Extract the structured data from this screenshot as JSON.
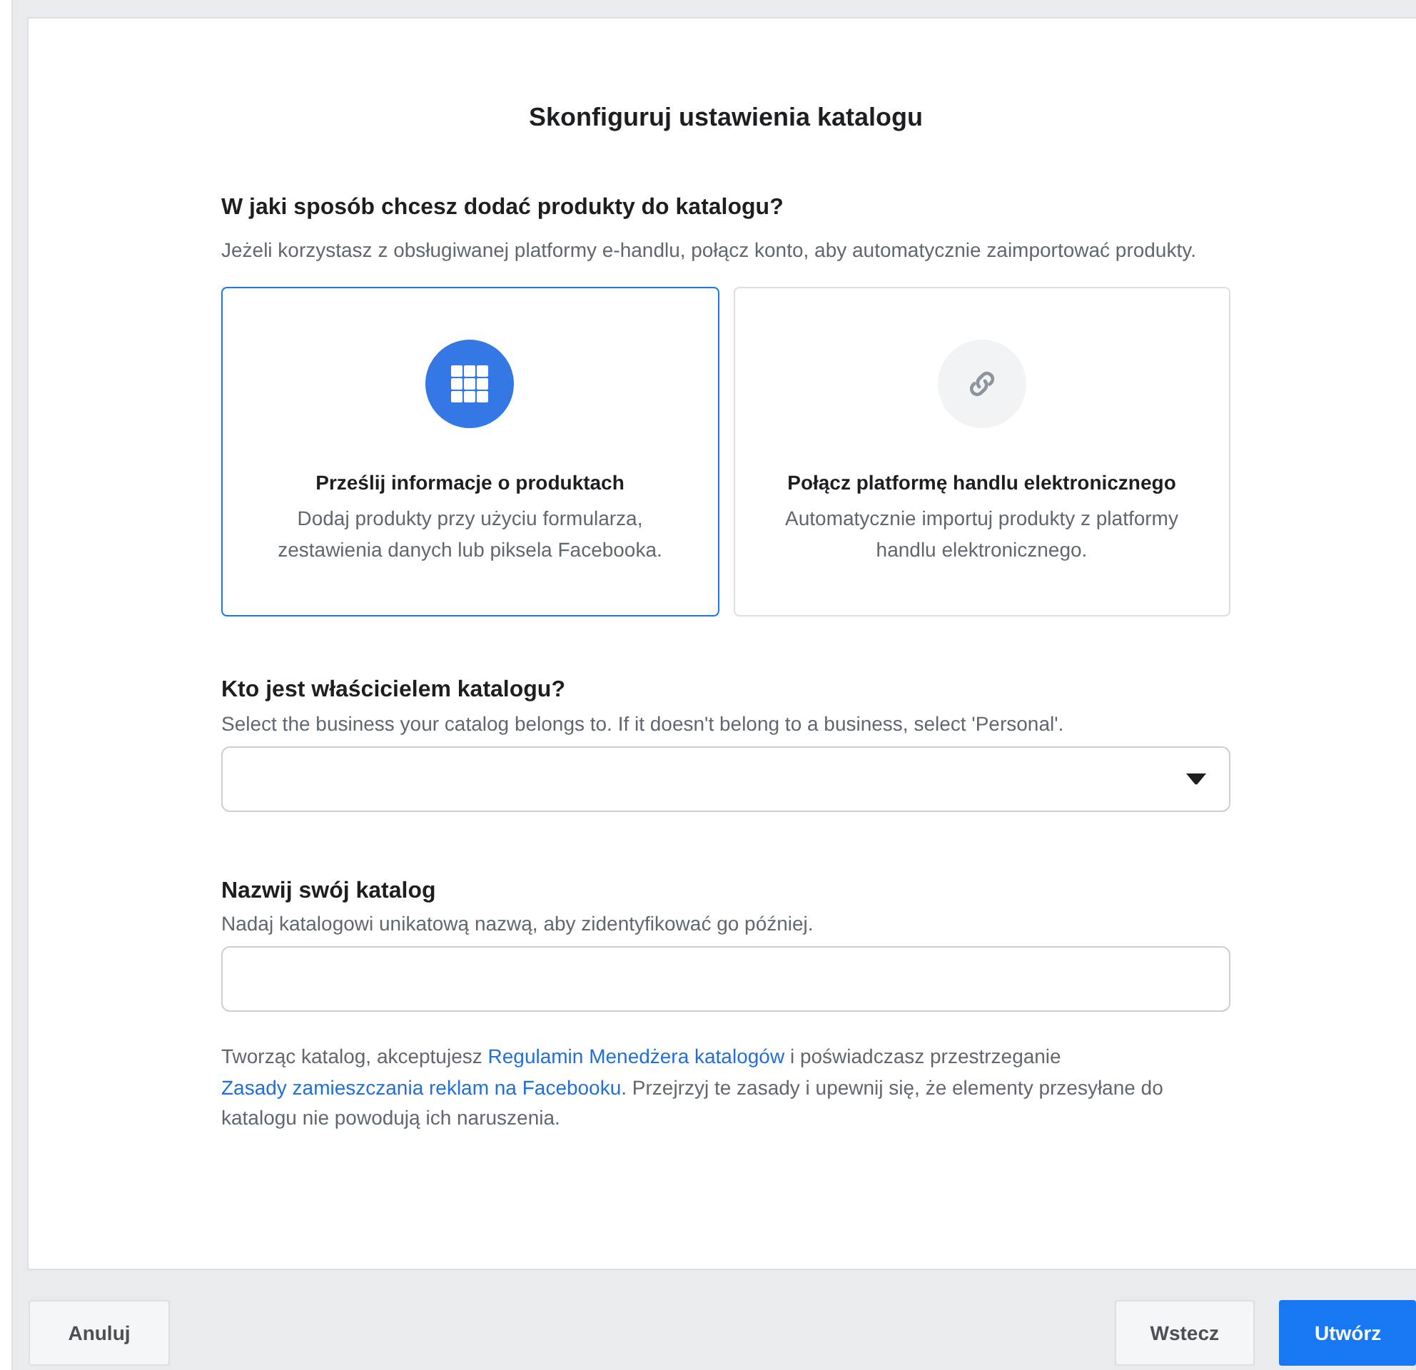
{
  "title": "Skonfiguruj ustawienia katalogu",
  "method": {
    "heading": "W jaki sposób chcesz dodać produkty do katalogu?",
    "description": "Jeżeli korzystasz z obsługiwanej platformy e-handlu, połącz konto, aby automatycznie zaimportować produkty.",
    "options": [
      {
        "kind": "upload",
        "title": "Prześlij informacje o produktach",
        "description": "Dodaj produkty przy użyciu formularza, zestawienia danych lub piksela Facebooka.",
        "selected": true
      },
      {
        "kind": "connect",
        "title": "Połącz platformę handlu elektronicznego",
        "description": "Automatycznie importuj produkty z platformy handlu elektronicznego.",
        "selected": false
      }
    ]
  },
  "owner": {
    "heading": "Kto jest właścicielem katalogu?",
    "description": "Select the business your catalog belongs to. If it doesn't belong to a business, select 'Personal'."
  },
  "name": {
    "heading": "Nazwij swój katalog",
    "description": "Nadaj katalogowi unikatową nazwą, aby zidentyfikować go później."
  },
  "legal": [
    {
      "kind": "text",
      "text": "Tworząc katalog, akceptujesz "
    },
    {
      "kind": "link",
      "text": "Regulamin Menedżera katalogów"
    },
    {
      "kind": "text",
      "text": " i poświadczasz przestrzeganie "
    },
    {
      "kind": "link",
      "text": "Zasady zamieszczania reklam na Facebooku"
    },
    {
      "kind": "text",
      "text": ". Przejrzyj te zasady i upewnij się, że elementy przesyłane do katalogu nie powodują ich naruszenia."
    }
  ],
  "footer": {
    "left": [
      {
        "label": "Anuluj",
        "kind": "secondary"
      }
    ],
    "right": [
      {
        "label": "Wstecz",
        "kind": "secondary"
      },
      {
        "label": "Utwórz",
        "kind": "primary"
      }
    ]
  }
}
